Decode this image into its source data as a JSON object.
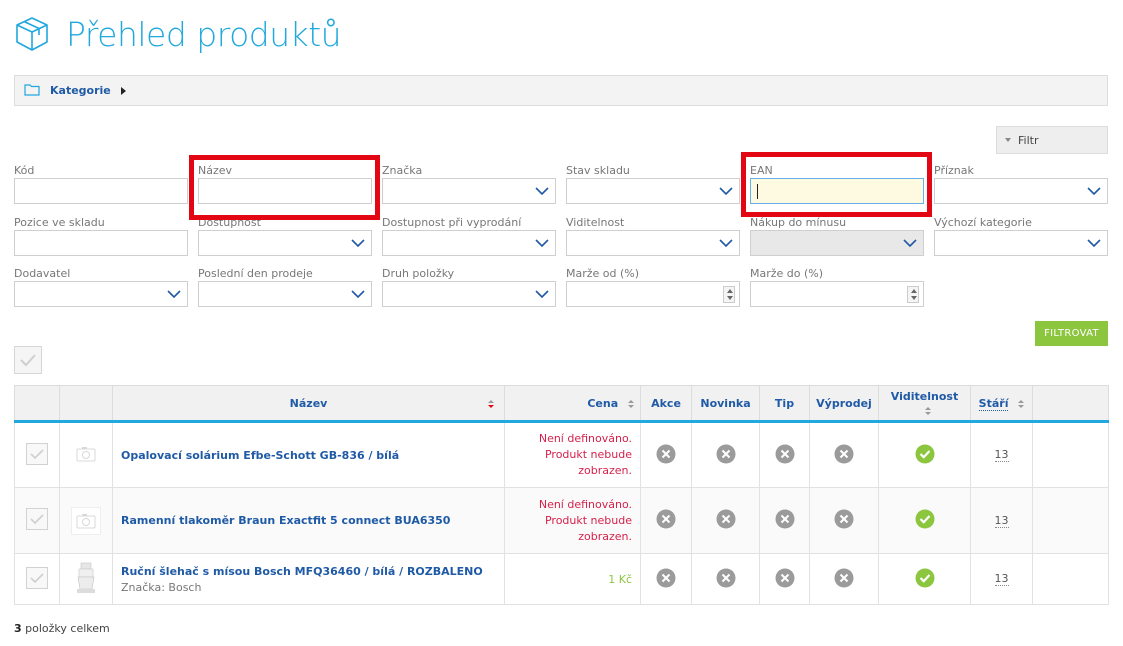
{
  "page": {
    "title": "Přehled produktů"
  },
  "breadcrumb": {
    "label": "Kategorie"
  },
  "filter_toggle": {
    "label": "Filtr"
  },
  "filters": {
    "kod": {
      "label": "Kód",
      "value": ""
    },
    "nazev": {
      "label": "Název",
      "value": ""
    },
    "znacka": {
      "label": "Značka",
      "value": ""
    },
    "stav_skladu": {
      "label": "Stav skladu",
      "value": ""
    },
    "ean": {
      "label": "EAN",
      "value": ""
    },
    "priznak": {
      "label": "Příznak",
      "value": ""
    },
    "pozice": {
      "label": "Pozice ve skladu",
      "value": ""
    },
    "dostupnost": {
      "label": "Dostupnost",
      "value": ""
    },
    "dostupnost_vyprodani": {
      "label": "Dostupnost při vyprodání",
      "value": ""
    },
    "viditelnost": {
      "label": "Viditelnost",
      "value": ""
    },
    "nakup_do_minusu": {
      "label": "Nákup do mínusu",
      "value": ""
    },
    "vychozi_kategorie": {
      "label": "Výchozí kategorie",
      "value": ""
    },
    "dodavatel": {
      "label": "Dodavatel",
      "value": ""
    },
    "posledni_den": {
      "label": "Poslední den prodeje",
      "value": ""
    },
    "druh_polozky": {
      "label": "Druh položky",
      "value": ""
    },
    "marze_od": {
      "label": "Marže od (%)",
      "value": ""
    },
    "marze_do": {
      "label": "Marže do (%)",
      "value": ""
    }
  },
  "filter_button": {
    "label": "FILTROVAT"
  },
  "table": {
    "headers": {
      "nazev": "Název",
      "cena": "Cena",
      "akce": "Akce",
      "novinka": "Novinka",
      "tip": "Tip",
      "vyprodej": "Výprodej",
      "viditelnost": "Viditelnost",
      "stari": "Stáří"
    },
    "rows": [
      {
        "name": "Opalovací solárium Efbe-Schott GB-836 / bílá",
        "brand": "",
        "price_lines": [
          "Není definováno.",
          "Produkt nebude",
          "zobrazen."
        ],
        "age": "13"
      },
      {
        "name": "Ramenní tlakoměr Braun Exactfit 5 connect BUA6350",
        "brand": "",
        "price_lines": [
          "Není definováno.",
          "Produkt nebude",
          "zobrazen."
        ],
        "age": "13"
      },
      {
        "name": "Ruční šlehač s mísou Bosch MFQ36460 / bílá / ROZBALENO",
        "brand": "Značka: Bosch",
        "price": "1 Kč",
        "age": "13"
      }
    ]
  },
  "footer": {
    "count": "3",
    "suffix": " položky celkem"
  },
  "colors": {
    "accent": "#21a8dd",
    "link": "#1f5aa6",
    "ok": "#8cc63f",
    "warn": "#d6214b",
    "highlight": "#e30613"
  },
  "icons": {
    "title": "box-icon",
    "breadcrumb": "folder-icon",
    "flag_off": "x-circle-icon",
    "visible_on": "check-circle-icon"
  }
}
